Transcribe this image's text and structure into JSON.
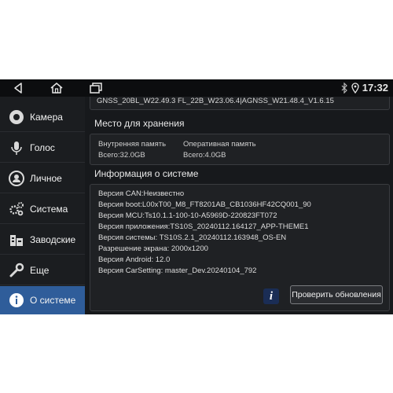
{
  "status": {
    "time": "17:32"
  },
  "sidebar": {
    "items": [
      {
        "label": "Камера",
        "icon": "camera-icon"
      },
      {
        "label": "Голос",
        "icon": "microphone-icon"
      },
      {
        "label": "Личное",
        "icon": "person-icon"
      },
      {
        "label": "Система",
        "icon": "gears-icon"
      },
      {
        "label": "Заводские",
        "icon": "factory-icon"
      },
      {
        "label": "Еще",
        "icon": "wrench-icon"
      },
      {
        "label": "О системе",
        "icon": "info-icon",
        "active": true
      }
    ]
  },
  "gnss": {
    "text": "GNSS_20BL_W22.49.3 FL_22B_W23.06.4|AGNSS_W21.48.4_V1.6.15"
  },
  "storage": {
    "title": "Место для хранения",
    "internal_label": "Внутренняя память",
    "internal_value": "Всего:32.0GB",
    "ram_label": "Оперативная память",
    "ram_value": "Всего:4.0GB"
  },
  "system_info": {
    "title": "Информация о системе",
    "lines": [
      "Версия CAN:Неизвестно",
      "Версия  boot:L00xT00_M8_FT8201AB_CB1036HF42CQ001_90",
      "Версия MCU:Ts10.1.1-100-10-A5969D-220823FT072",
      "Версия приложения:TS10S_20240112.164127_APP-THEME1",
      "Версия системы: TS10S.2.1_20240112.163948_OS-EN",
      "Разрешение экрана: 2000x1200",
      "Версия Android:  12.0",
      "Версия CarSetting:  master_Dev.20240104_792"
    ],
    "update_button": "Проверить обновления"
  },
  "colors": {
    "active": "#2f5d9a",
    "background": "#17191c"
  }
}
